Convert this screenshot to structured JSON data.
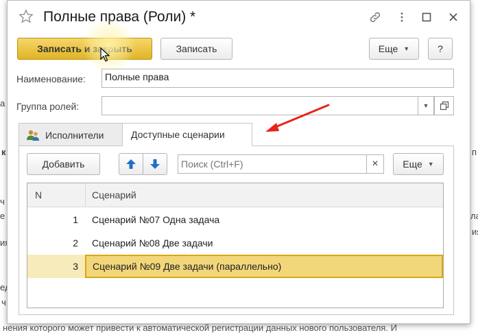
{
  "window": {
    "title": "Полные права (Роли) *"
  },
  "toolbar": {
    "save_close_label": "Записать и закрыть",
    "save_label": "Записать",
    "more_label": "Еще",
    "help_label": "?"
  },
  "form": {
    "name_label": "Наименование:",
    "name_value": "Полные права",
    "group_label": "Группа ролей:",
    "group_value": ""
  },
  "tabs": [
    {
      "label": "Исполнители"
    },
    {
      "label": "Доступные сценарии"
    }
  ],
  "panel": {
    "add_label": "Добавить",
    "search_placeholder": "Поиск (Ctrl+F)",
    "clear_label": "×",
    "more_label": "Еще"
  },
  "table": {
    "columns": [
      "N",
      "Сценарий"
    ],
    "rows": [
      {
        "n": "1",
        "name": "Сценарий №07 Одна задача"
      },
      {
        "n": "2",
        "name": "Сценарий №08 Две задачи"
      },
      {
        "n": "3",
        "name": "Сценарий №09 Две задачи (параллельно)"
      }
    ]
  },
  "background": {
    "bottom_text": "нения которого может привести к автоматической регистрации данных нового пользователя. И",
    "left_fragments": [
      "а",
      "к",
      "ч",
      "е",
      "ия",
      "ед",
      "ч"
    ],
    "right_fragments": [
      "п",
      "ла",
      "ия"
    ]
  },
  "colors": {
    "primary_button": "#e0b424",
    "selection_row": "#f7ebbb",
    "selection_cell": "#f2d67a",
    "arrow_blue": "#1f6fc9",
    "annotation_red": "#e8231b"
  }
}
